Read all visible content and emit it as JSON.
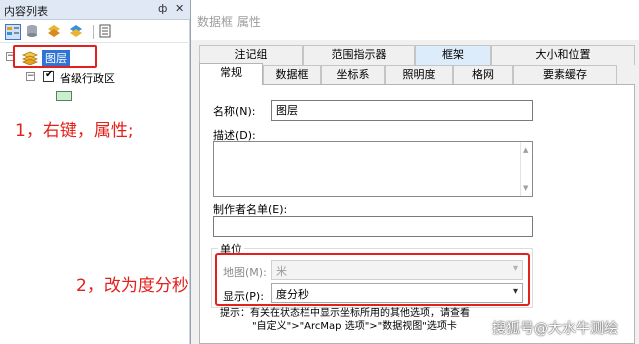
{
  "toc": {
    "title": "内容列表",
    "pin_glyph": "ф",
    "close_glyph": "✕",
    "layers_label": "图层",
    "layer_name": "省级行政区",
    "layer_checked": true,
    "swatch_color": "#c9eed0"
  },
  "annotations": {
    "step1": "1，右键，属性;",
    "step2": "2，改为度分秒",
    "color": "#e3201b"
  },
  "dialog": {
    "title": "数据框 属性",
    "tabs_row1": [
      "注记组",
      "范围指示器",
      "框架",
      "大小和位置"
    ],
    "tabs_row2": [
      "常规",
      "数据框",
      "坐标系",
      "照明度",
      "格网",
      "要素缓存"
    ],
    "selected_tab": "常规",
    "name_label": "名称(N):",
    "name_value": "图层",
    "desc_label": "描述(D):",
    "author_label": "制作者名单(E):",
    "author_value": "",
    "units_group": "单位",
    "map_label": "地图(M):",
    "map_value": "米",
    "display_label": "显示(P):",
    "display_value": "度分秒",
    "hint_line1": "提示：有关在状态栏中显示坐标所用的其他选项，请查看",
    "hint_line2": "\"自定义\">\"ArcMap 选项\">\"数据视图\"选项卡"
  },
  "watermark": "搜狐号@大水牛测绘"
}
